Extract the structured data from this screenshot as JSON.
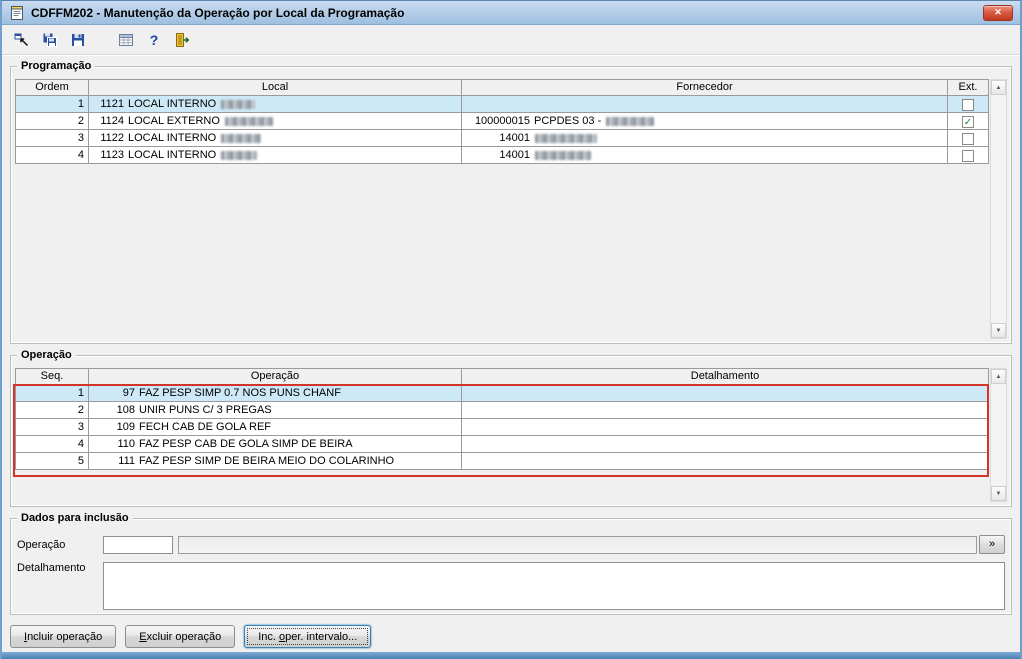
{
  "window": {
    "title": "CDFFM202 - Manutenção da Operação por Local da Programação",
    "close_glyph": "✕"
  },
  "toolbar": {
    "help_glyph": "?"
  },
  "icons": {
    "check": "✓",
    "scroll_up": "▲",
    "scroll_down": "▼"
  },
  "programacao": {
    "label": "Programação",
    "columns": {
      "ordem": "Ordem",
      "local": "Local",
      "fornecedor": "Fornecedor",
      "ext": "Ext."
    },
    "rows": [
      {
        "ordem": "1",
        "local_num": "1121",
        "local_name": "LOCAL INTERNO",
        "local_redact": 34,
        "forn_num": "",
        "forn_name": "",
        "forn_redact": 0,
        "ext": false,
        "selected": true
      },
      {
        "ordem": "2",
        "local_num": "1124",
        "local_name": "LOCAL EXTERNO",
        "local_redact": 48,
        "forn_num": "100000015",
        "forn_name": "PCPDES 03 -",
        "forn_redact": 48,
        "ext": true,
        "selected": false
      },
      {
        "ordem": "3",
        "local_num": "1122",
        "local_name": "LOCAL INTERNO",
        "local_redact": 40,
        "forn_num": "14001",
        "forn_name": "",
        "forn_redact": 62,
        "ext": false,
        "selected": false
      },
      {
        "ordem": "4",
        "local_num": "1123",
        "local_name": "LOCAL INTERNO",
        "local_redact": 36,
        "forn_num": "14001",
        "forn_name": "",
        "forn_redact": 56,
        "ext": false,
        "selected": false
      }
    ]
  },
  "operacao": {
    "label": "Operação",
    "columns": {
      "seq": "Seq.",
      "operacao": "Operação",
      "detalhamento": "Detalhamento"
    },
    "rows": [
      {
        "seq": "1",
        "num": "97",
        "desc": "FAZ PESP SIMP 0.7 NOS PUNS CHANF",
        "det": "",
        "selected": true
      },
      {
        "seq": "2",
        "num": "108",
        "desc": "UNIR PUNS C/ 3 PREGAS",
        "det": "",
        "selected": false
      },
      {
        "seq": "3",
        "num": "109",
        "desc": "FECH CAB DE GOLA REF",
        "det": "",
        "selected": false
      },
      {
        "seq": "4",
        "num": "110",
        "desc": "FAZ PESP CAB DE GOLA SIMP DE BEIRA",
        "det": "",
        "selected": false
      },
      {
        "seq": "5",
        "num": "111",
        "desc": "FAZ PESP SIMP DE BEIRA MEIO DO COLARINHO",
        "det": "",
        "selected": false
      }
    ]
  },
  "inclusao": {
    "label": "Dados para inclusão",
    "operacao_label": "Operação",
    "operacao_value": "",
    "operacao_desc_value": "",
    "more_label": "»",
    "detalhamento_label": "Detalhamento",
    "detalhamento_value": ""
  },
  "actions": {
    "incluir": {
      "pre": "",
      "key": "I",
      "post": "ncluir operação"
    },
    "excluir": {
      "pre": "",
      "key": "E",
      "post": "xcluir operação"
    },
    "intervalo": {
      "pre": "Inc. ",
      "key": "o",
      "post": "per. intervalo..."
    }
  },
  "annotation": {
    "color": "#d2342a"
  }
}
